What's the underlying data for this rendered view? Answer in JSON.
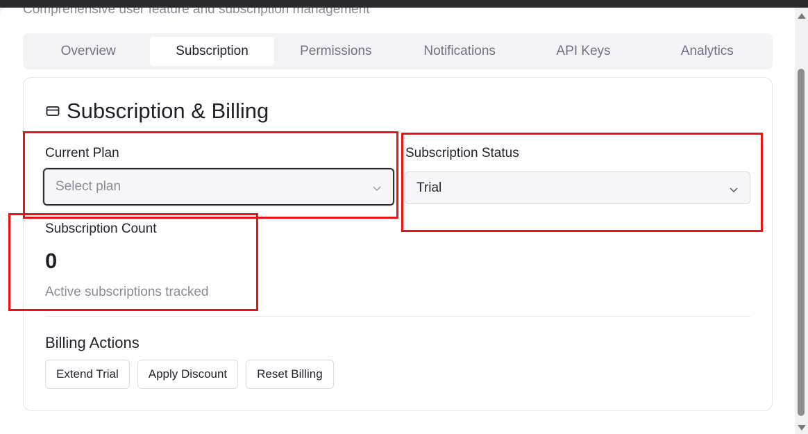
{
  "header": {
    "subtitle": "Comprehensive user feature and subscription management"
  },
  "tabs": [
    {
      "label": "Overview"
    },
    {
      "label": "Subscription",
      "active": true
    },
    {
      "label": "Permissions"
    },
    {
      "label": "Notifications"
    },
    {
      "label": "API Keys"
    },
    {
      "label": "Analytics"
    }
  ],
  "billing": {
    "title": "Subscription & Billing",
    "icon": "credit-card-icon",
    "current_plan": {
      "label": "Current Plan",
      "placeholder": "Select plan"
    },
    "subscription_status": {
      "label": "Subscription Status",
      "value": "Trial"
    },
    "subscription_count": {
      "label": "Subscription Count",
      "value": "0",
      "hint": "Active subscriptions tracked"
    },
    "actions": {
      "title": "Billing Actions",
      "buttons": [
        "Extend Trial",
        "Apply Discount",
        "Reset Billing"
      ]
    }
  },
  "colors": {
    "highlight": "#ee1111",
    "text_primary": "#1f1f2b",
    "text_muted": "#8a8a99"
  }
}
